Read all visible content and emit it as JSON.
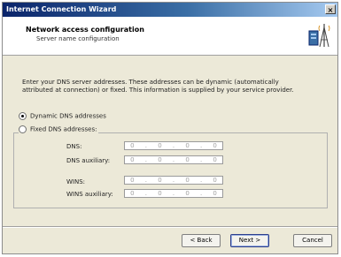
{
  "window": {
    "title": "Internet Connection Wizard",
    "close_glyph": "×"
  },
  "header": {
    "title": "Network access configuration",
    "subtitle": "Server name configuration",
    "icon": "network-server-icon"
  },
  "intro_text": "Enter your DNS server addresses. These addresses can be dynamic (automatically attributed at connection) or fixed. This information is supplied by your service provider.",
  "options": {
    "dynamic": {
      "label": "Dynamic DNS addresses",
      "selected": true
    },
    "fixed": {
      "label": "Fixed DNS addresses:",
      "selected": false
    }
  },
  "fields": [
    {
      "label": "DNS:",
      "octets": [
        "0",
        "0",
        "0",
        "0"
      ]
    },
    {
      "label": "DNS auxiliary:",
      "octets": [
        "0",
        "0",
        "0",
        "0"
      ]
    },
    {
      "label": "WINS:",
      "octets": [
        "0",
        "0",
        "0",
        "0"
      ]
    },
    {
      "label": "WINS auxiliary:",
      "octets": [
        "0",
        "0",
        "0",
        "0"
      ]
    }
  ],
  "buttons": {
    "back": "< Back",
    "next": "Next >",
    "cancel": "Cancel"
  }
}
